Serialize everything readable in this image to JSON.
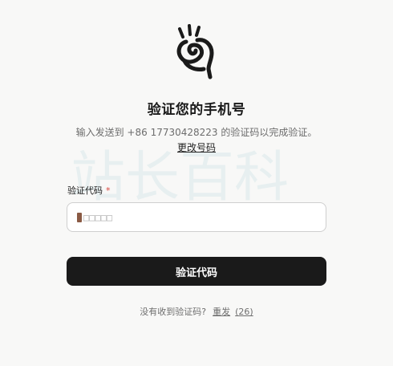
{
  "heading": {
    "title": "验证您的手机号",
    "subtitle": "输入发送到 +86 17730428223 的验证码以完成验证。",
    "change_number_label": "更改号码"
  },
  "watermark": {
    "text": "站长百科"
  },
  "form": {
    "code_label": "验证代码",
    "required_mark": "*",
    "code_value": "□□□□□"
  },
  "submit": {
    "label": "验证代码"
  },
  "resend": {
    "prompt": "没有收到验证码?",
    "link_label": "重发",
    "countdown": "(26)"
  },
  "colors": {
    "background": "#f8f8f7",
    "button": "#1a1a1a",
    "required": "#d9443c"
  },
  "icons": {
    "logo": "hand-swirl-logo-icon"
  }
}
